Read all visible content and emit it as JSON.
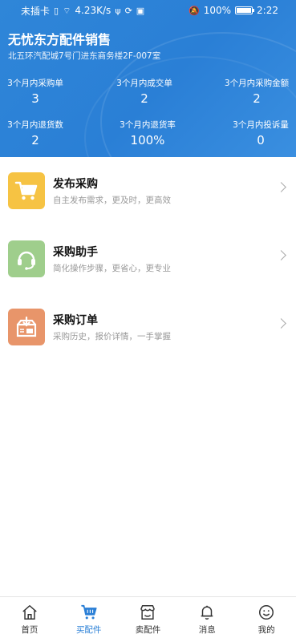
{
  "status_bar": {
    "carrier": "未插卡",
    "speed": "4.23K/s",
    "battery": "100%",
    "time": "2:22"
  },
  "shop": {
    "name": "无忧东方配件销售",
    "address": "北五环汽配城7号门进东商务楼2F-007室"
  },
  "stats": [
    {
      "label": "3个月内采购单",
      "value": "3"
    },
    {
      "label": "3个月内成交单",
      "value": "2"
    },
    {
      "label": "3个月内采购金额",
      "value": "2"
    },
    {
      "label": "3个月内退货数",
      "value": "2"
    },
    {
      "label": "3个月内退货率",
      "value": "100%"
    },
    {
      "label": "3个月内投诉量",
      "value": "0"
    }
  ],
  "menu": [
    {
      "title": "发布采购",
      "subtitle": "自主发布需求，更及时，更高效",
      "icon": "cart-icon",
      "color": "#f6c343"
    },
    {
      "title": "采购助手",
      "subtitle": "简化操作步骤，更省心，更专业",
      "icon": "headset-icon",
      "color": "#9fce8c"
    },
    {
      "title": "采购订单",
      "subtitle": "采购历史，报价详情，一手掌握",
      "icon": "order-box-icon",
      "color": "#e8956a"
    }
  ],
  "tabs": [
    {
      "label": "首页",
      "icon": "home-icon",
      "active": false
    },
    {
      "label": "买配件",
      "icon": "cart-icon",
      "active": true
    },
    {
      "label": "卖配件",
      "icon": "store-icon",
      "active": false
    },
    {
      "label": "消息",
      "icon": "bell-icon",
      "active": false
    },
    {
      "label": "我的",
      "icon": "smile-icon",
      "active": false
    }
  ],
  "colors": {
    "primary": "#2a7fd6",
    "header_bg": "#2f86d8"
  }
}
